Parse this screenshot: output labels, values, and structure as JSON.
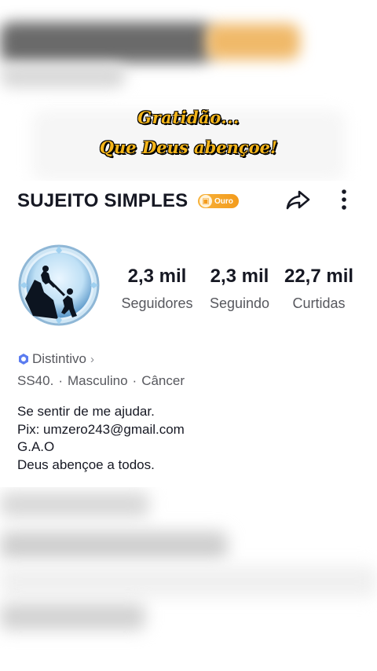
{
  "banner": {
    "line1": "Gratidão...",
    "line2": "Que Deus abençoe!"
  },
  "profile": {
    "username": "SUJEITO SIMPLES",
    "badge_label": "Ouro",
    "stats": [
      {
        "value": "2,3 mil",
        "label": "Seguidores"
      },
      {
        "value": "2,3 mil",
        "label": "Seguindo"
      },
      {
        "value": "22,7 mil",
        "label": "Curtidas"
      }
    ],
    "distintivo": "Distintivo",
    "meta": {
      "code": "SS40.",
      "gender": "Masculino",
      "sign": "Câncer",
      "separator": "·"
    },
    "bio": [
      "Se sentir de me ajudar.",
      "Pix: umzero243@gmail.com",
      "G.A.O",
      "Deus abençoe a todos."
    ]
  },
  "icons": {
    "share": "share-icon",
    "more": "more-vertical-icon",
    "badge": "gold-badge-icon",
    "distintivo": "hexagon-badge-icon",
    "chevron": "chevron-right-icon"
  },
  "colors": {
    "gold": "#f4b51a",
    "badge_orange": "#f39b1c",
    "text_primary": "#161823",
    "text_secondary": "#57585e",
    "distintivo_blue": "#5b7cf0"
  }
}
